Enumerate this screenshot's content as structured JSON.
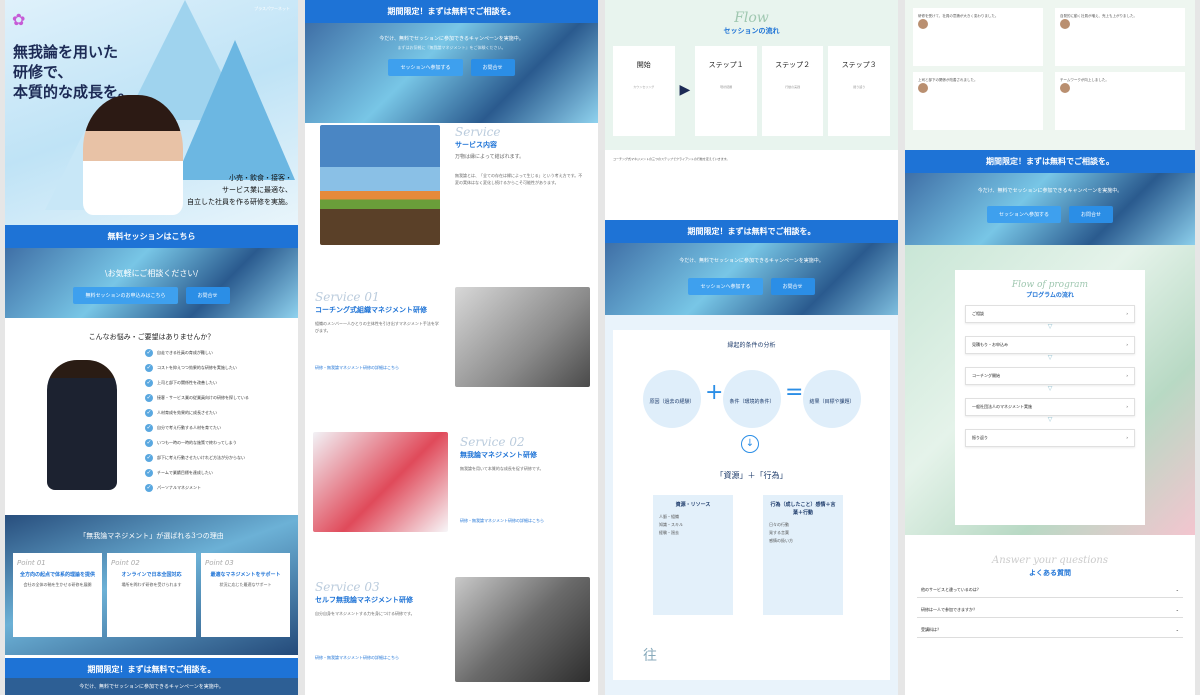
{
  "col1": {
    "brand_small": "プラスパワーネット",
    "headline": [
      "無我論を用いた",
      "研修で、",
      "本質的な成長を。"
    ],
    "tagline": [
      "小売・飲食・接客・",
      "サービス業に最適な、",
      "自立した社員を作る研修を実施。"
    ],
    "free_bar": "無料セッションはこちら",
    "consult": "\\お気軽にご相談ください/",
    "btn_session": "無料セッションのお申込みはこちら",
    "btn_contact": "お問合せ",
    "worry_title": "こんなお悩み・ご要望はありませんか？",
    "worries": [
      "自走できる社員の育成が難しい",
      "コストを抑えつつ効果的な研修を実施したい",
      "上司と部下の関係性を改善したい",
      "接客・サービス業の従業員向けの研修を探している",
      "人材育成を効果的に成長させたい",
      "自分で考え行動する人材を育てたい",
      "いつも一時の一時的な施策で終わってしまう",
      "部下に考え行動させたいけれど方法が分からない",
      "チームで業績目標を達成したい",
      "パーソナルマネジメント"
    ],
    "reasons_title": "「無我論マネジメント」が選ばれる3つの理由",
    "points": [
      {
        "tag": "Point 01",
        "title": "全方向の起点で体系的理論を提供",
        "text": "会社の全体の軸を生かせる研修を展開"
      },
      {
        "tag": "Point 02",
        "title": "オンラインで日本全国対応",
        "text": "場所を問わず研修を受けられます"
      },
      {
        "tag": "Point 03",
        "title": "最適なマネジメントをサポート",
        "text": "状況に応じた最適なサポート"
      }
    ],
    "bar_bottom": "期間限定！まずは無料でご相談を。",
    "bottom": "今だけ、無料でセッションに参加できるキャンペーンを実施中。"
  },
  "col2": {
    "bar": "期間限定！まずは無料でご相談を。",
    "sub": "今だけ、無料でセッションに参加できるキャンペーンを実施中。",
    "sub2": "まずはお気軽に『無我論マネジメント』をご体験ください。",
    "btn_session": "セッションへ参加する",
    "btn_contact": "お問合せ",
    "service_tag": "Service",
    "service_title": "サービス内容",
    "service_sub": "万物は縁によって結ばれます。",
    "service_text": "無我論とは、「全ての存在は縁によって生じる」という考え方です。不変の実体はなく変化し続けるからこそ可能性があります。",
    "s1_tag": "Service 01",
    "s1_title": "コーチング式組織マネジメント研修",
    "s1_text": "組織のメンバー一人ひとりの主体性を引き出すマネジメント手法を学びます。",
    "s1_link": "研修・無我論マネジメント研修の詳細はこちら",
    "s2_tag": "Service 02",
    "s2_title": "無我論マネジメント研修",
    "s2_text": "無我論を用いて本質的な成長を促す研修です。",
    "s2_link": "研修・無我論マネジメント研修の詳細はこちら",
    "s3_tag": "Service 03",
    "s3_title": "セルフ無我論マネジメント研修",
    "s3_text": "自分自身をマネジメントする力を身につける研修です。",
    "s3_link": "研修・無我論マネジメント研修の詳細はこちら"
  },
  "col3": {
    "flow_tag": "Flow",
    "flow_title": "セッションの流れ",
    "steps": [
      {
        "name": "開始",
        "detail": "カウンセリング"
      },
      {
        "name": "ステップ１",
        "detail": "現状把握"
      },
      {
        "name": "ステップ２",
        "detail": "行動の実践"
      },
      {
        "name": "ステップ３",
        "detail": "振り返り"
      }
    ],
    "note": "コーチング式マネジメントの三つのステップでクライアントの行動を変えていきます。",
    "bar": "期間限定！まずは無料でご相談を。",
    "sub": "今だけ、無料でセッションに参加できるキャンペーンを実施中。",
    "btn_session": "セッションへ参加する",
    "btn_contact": "お問合せ",
    "analysis_title": "縁起的条件の分析",
    "c1": "原因（過去の経験）",
    "c2": "条件（環境的条件）",
    "c3": "結果（目標や課題）",
    "formula": "「資源」＋「行為」",
    "box1_title": "資源・リソース",
    "box1_items": [
      "人脈・組織",
      "知識・スキル",
      "経験・過去"
    ],
    "box2_title": "行為（成したこと）感情＋言葉＋行動",
    "box2_items": [
      "日々の行動",
      "発する言葉",
      "感情の扱い方"
    ],
    "footer": "往"
  },
  "col4": {
    "testimonials": [
      "研修を受けて、社員の意識が大きく変わりました。",
      "自発的に動く社員が増え、売上も上がりました。",
      "上司と部下の関係が改善されました。",
      "チームワークが向上しました。"
    ],
    "bar": "期間限定！まずは無料でご相談を。",
    "sub": "今だけ、無料でセッションに参加できるキャンペーンを実施中。",
    "btn_session": "セッションへ参加する",
    "btn_contact": "お問合せ",
    "prog_tag": "Flow of program",
    "prog_title": "プログラムの流れ",
    "prog_items": [
      "ご相談",
      "見積もり・お申込み",
      "コーチング開始",
      "一般社団法人のマネジメント実施",
      "振り返り"
    ],
    "faq_tag": "Answer your questions",
    "faq_title": "よくある質問",
    "faqs": [
      "他のサービスと違っているのは？",
      "研修は一人で参加できますか？",
      "受講料は？"
    ]
  }
}
